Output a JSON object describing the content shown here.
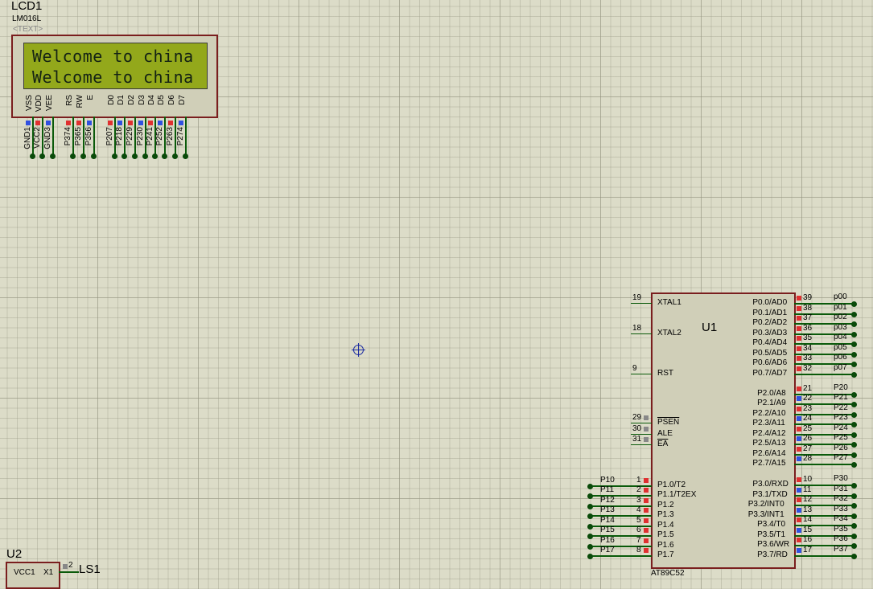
{
  "lcd": {
    "ref": "LCD1",
    "part": "LM016L",
    "text_placeholder": "<TEXT>",
    "line1": "Welcome to china",
    "line2": "Welcome to china",
    "pins": [
      "VSS",
      "VDD",
      "VEE",
      "RS",
      "RW",
      "E",
      "D0",
      "D1",
      "D2",
      "D3",
      "D4",
      "D5",
      "D6",
      "D7"
    ],
    "pin_nets": [
      "GND1",
      "VCC2",
      "GND3",
      "P374",
      "P365",
      "P356",
      "P207",
      "P218",
      "P229",
      "P230",
      "P241",
      "P252",
      "P263",
      "P274"
    ]
  },
  "mcu": {
    "ref": "U1",
    "part": "AT89C52",
    "left_pins": [
      {
        "num": "19",
        "name": "XTAL1"
      },
      {
        "num": "18",
        "name": "XTAL2"
      },
      {
        "num": "9",
        "name": "RST"
      },
      {
        "num": "29",
        "name": "PSEN"
      },
      {
        "num": "30",
        "name": "ALE"
      },
      {
        "num": "31",
        "name": "EA"
      },
      {
        "num": "1",
        "name": "P1.0/T2",
        "net": "P10"
      },
      {
        "num": "2",
        "name": "P1.1/T2EX",
        "net": "P11"
      },
      {
        "num": "3",
        "name": "P1.2",
        "net": "P12"
      },
      {
        "num": "4",
        "name": "P1.3",
        "net": "P13"
      },
      {
        "num": "5",
        "name": "P1.4",
        "net": "P14"
      },
      {
        "num": "6",
        "name": "P1.5",
        "net": "P15"
      },
      {
        "num": "7",
        "name": "P1.6",
        "net": "P16"
      },
      {
        "num": "8",
        "name": "P1.7",
        "net": "P17"
      }
    ],
    "right_pins": [
      {
        "num": "39",
        "name": "P0.0/AD0",
        "net": "p00"
      },
      {
        "num": "38",
        "name": "P0.1/AD1",
        "net": "p01"
      },
      {
        "num": "37",
        "name": "P0.2/AD2",
        "net": "p02"
      },
      {
        "num": "36",
        "name": "P0.3/AD3",
        "net": "p03"
      },
      {
        "num": "35",
        "name": "P0.4/AD4",
        "net": "p04"
      },
      {
        "num": "34",
        "name": "P0.5/AD5",
        "net": "p05"
      },
      {
        "num": "33",
        "name": "P0.6/AD6",
        "net": "p06"
      },
      {
        "num": "32",
        "name": "P0.7/AD7",
        "net": "p07"
      },
      {
        "num": "21",
        "name": "P2.0/A8",
        "net": "P20"
      },
      {
        "num": "22",
        "name": "P2.1/A9",
        "net": "P21"
      },
      {
        "num": "23",
        "name": "P2.2/A10",
        "net": "P22"
      },
      {
        "num": "24",
        "name": "P2.3/A11",
        "net": "P23"
      },
      {
        "num": "25",
        "name": "P2.4/A12",
        "net": "P24"
      },
      {
        "num": "26",
        "name": "P2.5/A13",
        "net": "P25"
      },
      {
        "num": "27",
        "name": "P2.6/A14",
        "net": "P26"
      },
      {
        "num": "28",
        "name": "P2.7/A15",
        "net": "P27"
      },
      {
        "num": "10",
        "name": "P3.0/RXD",
        "net": "P30"
      },
      {
        "num": "11",
        "name": "P3.1/TXD",
        "net": "P31"
      },
      {
        "num": "12",
        "name": "P3.2/INT0",
        "net": "P32"
      },
      {
        "num": "13",
        "name": "P3.3/INT1",
        "net": "P33"
      },
      {
        "num": "14",
        "name": "P3.4/T0",
        "net": "P34"
      },
      {
        "num": "15",
        "name": "P3.5/T1",
        "net": "P35"
      },
      {
        "num": "16",
        "name": "P3.6/WR",
        "net": "P36"
      },
      {
        "num": "17",
        "name": "P3.7/RD",
        "net": "P37"
      }
    ]
  },
  "u2": {
    "ref": "U2",
    "pin_left": "VCC1",
    "pin_right": "X1",
    "pin_num": "2",
    "net": "LS1"
  },
  "colors": {
    "background": "#dcdcc8",
    "component_border": "#7a1e1e",
    "wire": "#0a5a0a",
    "lcd_screen": "#93a81b"
  },
  "icons": {
    "cursor": "crosshair-icon"
  }
}
